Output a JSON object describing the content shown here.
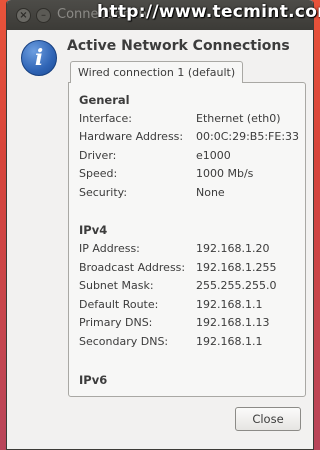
{
  "window": {
    "title": "Connection Information",
    "watermark": "http://www.tecmint.com",
    "close_glyph": "×",
    "minimize_glyph": "–"
  },
  "dialog": {
    "heading": "Active Network Connections",
    "info_icon_glyph": "i",
    "tab_label": "Wired connection 1 (default)"
  },
  "general": {
    "title": "General",
    "rows": [
      {
        "label": "Interface:",
        "value": "Ethernet (eth0)"
      },
      {
        "label": "Hardware Address:",
        "value": "00:0C:29:B5:FE:33"
      },
      {
        "label": "Driver:",
        "value": "e1000"
      },
      {
        "label": "Speed:",
        "value": "1000 Mb/s"
      },
      {
        "label": "Security:",
        "value": "None"
      }
    ]
  },
  "ipv4": {
    "title": "IPv4",
    "rows": [
      {
        "label": "IP Address:",
        "value": "192.168.1.20"
      },
      {
        "label": "Broadcast Address:",
        "value": "192.168.1.255"
      },
      {
        "label": "Subnet Mask:",
        "value": "255.255.255.0"
      },
      {
        "label": "Default Route:",
        "value": "192.168.1.1"
      },
      {
        "label": "Primary DNS:",
        "value": "192.168.1.13"
      },
      {
        "label": "Secondary DNS:",
        "value": "192.168.1.1"
      }
    ]
  },
  "ipv6": {
    "title": "IPv6"
  },
  "buttons": {
    "close_label": "Close"
  },
  "colors": {
    "titlebar": "#3c3b37",
    "window_bg": "#f2f1f0",
    "icon_blue": "#2f64b5",
    "desktop_orange": "#e9533a"
  },
  "icons": {
    "info": "info-icon",
    "close": "close-icon",
    "minimize": "minimize-icon"
  }
}
